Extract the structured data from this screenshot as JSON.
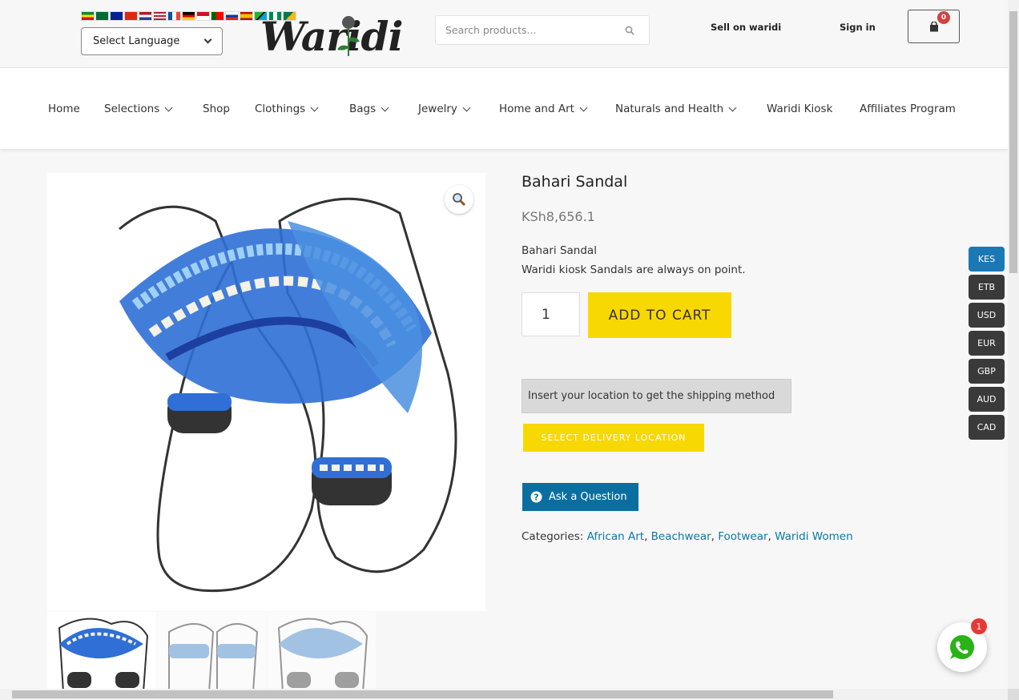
{
  "header": {
    "language_select": "Select Language",
    "logo_text": "Waridi",
    "search_placeholder": "Search products...",
    "sell_link": "Sell on waridi",
    "signin_link": "Sign in",
    "cart_count": "0"
  },
  "nav": {
    "items": [
      {
        "label": "Home",
        "dropdown": false
      },
      {
        "label": "Selections",
        "dropdown": true
      },
      {
        "label": "Shop",
        "dropdown": false
      },
      {
        "label": "Clothings",
        "dropdown": true
      },
      {
        "label": "Bags",
        "dropdown": true
      },
      {
        "label": "Jewelry",
        "dropdown": true
      },
      {
        "label": "Home and Art",
        "dropdown": true
      },
      {
        "label": "Naturals and Health",
        "dropdown": true
      },
      {
        "label": "Waridi Kiosk",
        "dropdown": false
      },
      {
        "label": "Affiliates Program",
        "dropdown": false
      }
    ]
  },
  "product": {
    "title": "Bahari Sandal",
    "price": "KSh8,656.1",
    "short_desc_title": "Bahari Sandal",
    "short_desc": "Waridi kiosk Sandals are always on point.",
    "quantity": "1",
    "add_to_cart": "ADD TO CART",
    "shipping_prompt": "Insert your location to get the shipping method",
    "delivery_button": "SELECT DELIVERY LOCATION",
    "ask_question": "Ask a Question",
    "categories_label": "Categories:",
    "categories": [
      "African Art",
      "Beachwear",
      "Footwear",
      "Waridi Women"
    ]
  },
  "currencies": [
    "KES",
    "ETB",
    "USD",
    "EUR",
    "GBP",
    "AUD",
    "CAD"
  ],
  "active_currency": "KES",
  "whatsapp_badge": "1",
  "colors": {
    "accent_yellow": "#f7d800",
    "ask_blue": "#0a6fa0",
    "link_blue": "#0a78a6",
    "currency_active": "#1a78b5"
  }
}
